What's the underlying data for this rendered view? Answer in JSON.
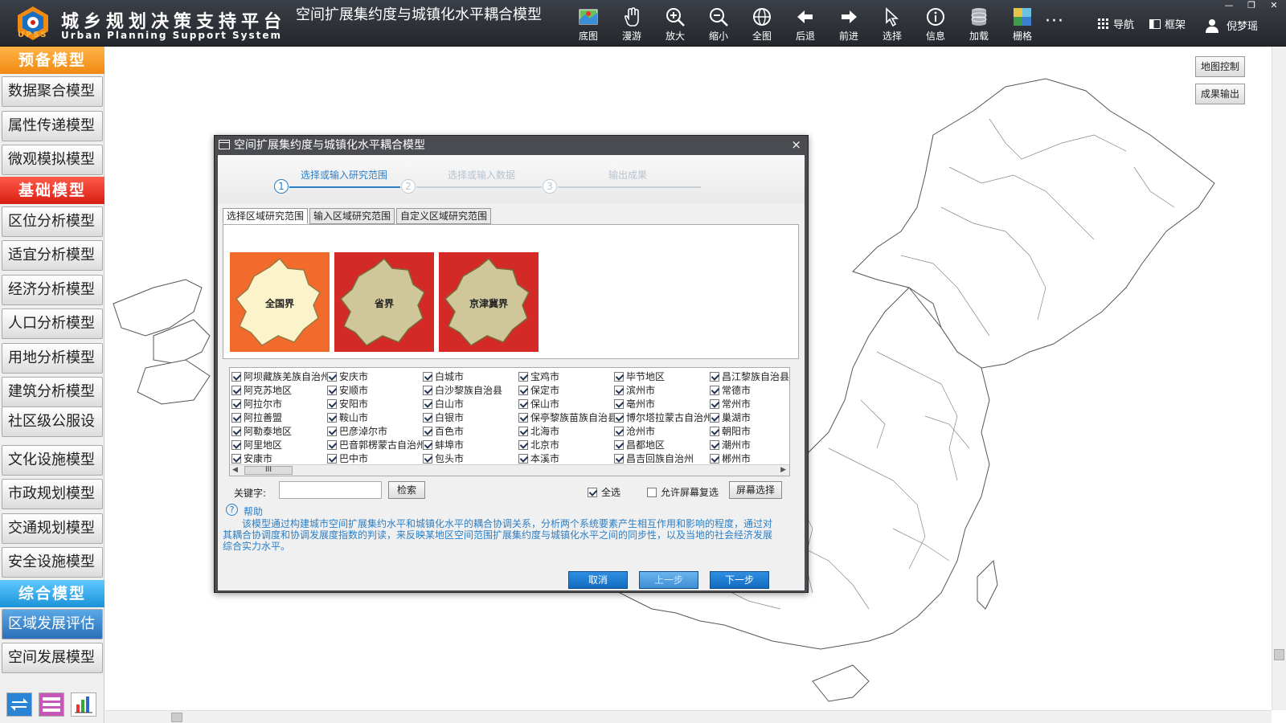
{
  "app": {
    "logo_text": "UPSS",
    "name_cn": "城乡规划决策支持平台",
    "name_en": "Urban Planning Support System",
    "page_title": "空间扩展集约度与城镇化水平耦合模型"
  },
  "toolbar": {
    "items": [
      {
        "label": "底图",
        "icon": "basemap-icon"
      },
      {
        "label": "漫游",
        "icon": "hand-pan-icon"
      },
      {
        "label": "放大",
        "icon": "zoom-in-icon"
      },
      {
        "label": "缩小",
        "icon": "zoom-out-icon"
      },
      {
        "label": "全图",
        "icon": "globe-icon"
      },
      {
        "label": "后退",
        "icon": "arrow-left-icon"
      },
      {
        "label": "前进",
        "icon": "arrow-right-icon"
      },
      {
        "label": "选择",
        "icon": "cursor-select-icon"
      },
      {
        "label": "信息",
        "icon": "info-icon"
      },
      {
        "label": "加载",
        "icon": "database-icon"
      },
      {
        "label": "栅格",
        "icon": "raster-icon"
      }
    ],
    "more": "···",
    "nav_label": "导航",
    "frame_label": "框架",
    "user_name": "倪梦瑶"
  },
  "sidebar": {
    "sections": [
      {
        "title": "预备模型",
        "items": [
          "数据聚合模型",
          "属性传递模型",
          "微观模拟模型"
        ]
      },
      {
        "title": "基础模型",
        "items": [
          "区位分析模型",
          "适宜分析模型",
          "经济分析模型",
          "人口分析模型",
          "用地分析模型",
          "建筑分析模型",
          "社区级公服设",
          "文化设施模型",
          "市政规划模型",
          "交通规划模型",
          "安全设施模型"
        ]
      },
      {
        "title": "综合模型",
        "items": [
          "区域发展评估",
          "空间发展模型"
        ]
      }
    ]
  },
  "map_controls": {
    "map_control": "地图控制",
    "result_output": "成果输出"
  },
  "dialog": {
    "title": "空间扩展集约度与城镇化水平耦合模型",
    "close": "×",
    "steps": [
      {
        "num": "1",
        "label": "选择或输入研究范围"
      },
      {
        "num": "2",
        "label": "选择或输入数据"
      },
      {
        "num": "3",
        "label": "输出成果"
      }
    ],
    "tabs": [
      "选择区域研究范围",
      "输入区域研究范围",
      "自定义区域研究范围"
    ],
    "region_cards": [
      {
        "label": "全国界",
        "bg": "#f26a2c"
      },
      {
        "label": "省界",
        "bg": "#d42a27"
      },
      {
        "label": "京津冀界",
        "bg": "#d42a27"
      }
    ],
    "regions": [
      [
        "阿坝藏族羌族自治州",
        "安庆市",
        "白城市",
        "宝鸡市",
        "毕节地区",
        "昌江黎族自治县"
      ],
      [
        "阿克苏地区",
        "安顺市",
        "白沙黎族自治县",
        "保定市",
        "滨州市",
        "常德市"
      ],
      [
        "阿拉尔市",
        "安阳市",
        "白山市",
        "保山市",
        "亳州市",
        "常州市"
      ],
      [
        "阿拉善盟",
        "鞍山市",
        "白银市",
        "保亭黎族苗族自治县",
        "博尔塔拉蒙古自治州",
        "巢湖市"
      ],
      [
        "阿勒泰地区",
        "巴彦淖尔市",
        "百色市",
        "北海市",
        "沧州市",
        "朝阳市"
      ],
      [
        "阿里地区",
        "巴音郭楞蒙古自治州",
        "蚌埠市",
        "北京市",
        "昌都地区",
        "潮州市"
      ],
      [
        "安康市",
        "巴中市",
        "包头市",
        "本溪市",
        "昌吉回族自治州",
        "郴州市"
      ]
    ],
    "scroll_thumb": "III",
    "keyword_label": "关键字:",
    "keyword_value": "",
    "search_button": "检索",
    "select_all": "全选",
    "allow_screen": "允许屏幕复选",
    "screen_select": "屏幕选择",
    "help_title": "帮助",
    "help_text": "该模型通过构建城市空间扩展集约水平和城镇化水平的耦合协调关系，分析两个系统要素产生相互作用和影响的程度，通过对其耦合协调度和协调发展度指数的判读，来反映某地区空间范围扩展集约度与城镇化水平之间的同步性，以及当地的社会经济发展综合实力水平。",
    "cancel": "取消",
    "prev": "上一步",
    "next": "下一步"
  },
  "colors": {
    "accent_blue": "#1b7fd4",
    "header_bg": "#2b2e34",
    "orange": "#f08a12",
    "red": "#d81f14"
  }
}
